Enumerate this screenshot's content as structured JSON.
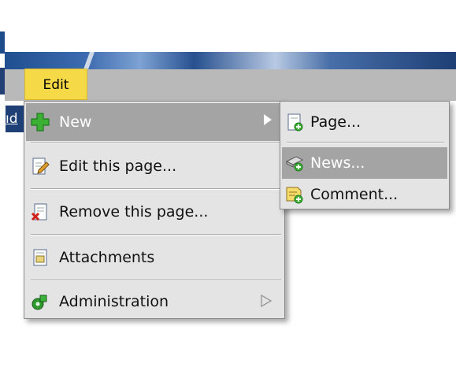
{
  "menubar": {
    "edit_tab": "Edit",
    "side_link_fragment": "ıd"
  },
  "edit_menu": {
    "items": [
      {
        "label": "New",
        "icon": "plus-icon",
        "has_submenu": true,
        "highlighted": true
      },
      {
        "label": "Edit this page...",
        "icon": "edit-page-icon"
      },
      {
        "label": "Remove this page...",
        "icon": "remove-page-icon"
      },
      {
        "label": "Attachments",
        "icon": "attachment-icon"
      },
      {
        "label": "Administration",
        "icon": "administration-icon",
        "has_submenu": true
      }
    ]
  },
  "new_submenu": {
    "items": [
      {
        "label": "Page...",
        "icon": "new-page-icon"
      },
      {
        "label": "News...",
        "icon": "news-icon",
        "highlighted": true
      },
      {
        "label": "Comment...",
        "icon": "comment-icon"
      }
    ]
  },
  "colors": {
    "menu_bg": "#e4e4e4",
    "highlight": "#a4a4a4",
    "edit_tab": "#f6d946",
    "banner": "#1f4f8f"
  }
}
